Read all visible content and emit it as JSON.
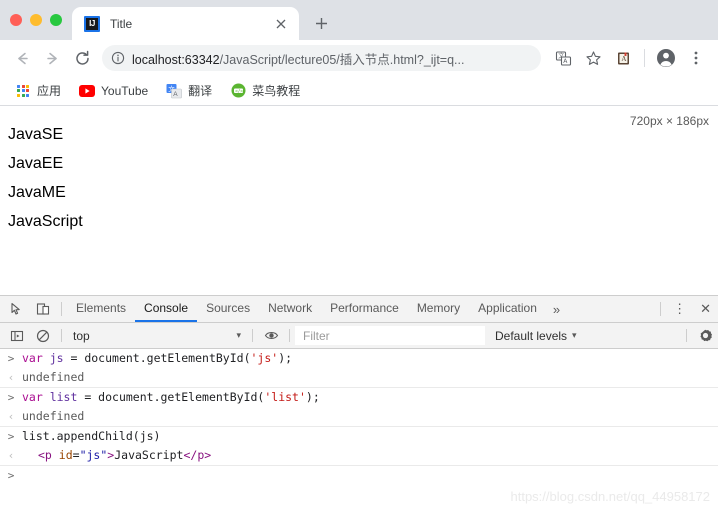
{
  "window": {
    "traffic_lights": [
      {
        "name": "close",
        "color": "#ff5f57"
      },
      {
        "name": "minimize",
        "color": "#febc2e"
      },
      {
        "name": "zoom",
        "color": "#28c840"
      }
    ]
  },
  "tabstrip": {
    "tab": {
      "favicon_label": "IJ",
      "title": "Title",
      "close_label": "×"
    },
    "new_tab_label": "+"
  },
  "toolbar": {
    "back_title": "Back",
    "forward_title": "Forward",
    "reload_title": "Reload",
    "url_host": "localhost:63342",
    "url_path": "/JavaScript/lecture05/插入节点.html?_ijt=q...",
    "url_full": "localhost:63342/JavaScript/lecture05/插入节点.html?_ijt=q...",
    "translate_title": "Translate this page",
    "bookmark_title": "Bookmark this tab",
    "extension_title": "Dictionary extension",
    "profile_title": "Profile",
    "menu_title": "Customize and control Google Chrome"
  },
  "bookmarks": [
    {
      "label": "应用",
      "icon": "apps-grid-icon"
    },
    {
      "label": "YouTube",
      "icon": "youtube-icon"
    },
    {
      "label": "翻译",
      "icon": "google-translate-icon"
    },
    {
      "label": "菜鸟教程",
      "icon": "runoob-icon"
    }
  ],
  "viewport": {
    "paragraphs": [
      "JavaSE",
      "JavaEE",
      "JavaME",
      "JavaScript"
    ],
    "dimension_tooltip": "720px × 186px"
  },
  "devtools": {
    "tabs": [
      {
        "label": "Elements",
        "active": false
      },
      {
        "label": "Console",
        "active": true
      },
      {
        "label": "Sources",
        "active": false
      },
      {
        "label": "Network",
        "active": false
      },
      {
        "label": "Performance",
        "active": false
      },
      {
        "label": "Memory",
        "active": false
      },
      {
        "label": "Application",
        "active": false
      }
    ],
    "more_tabs_label": "»",
    "dock_menu_label": "⋮",
    "close_label": "✕",
    "inspect_title": "Inspect element",
    "device_title": "Toggle device toolbar",
    "filterbar": {
      "sidebar_title": "Show console sidebar",
      "clear_title": "Clear console",
      "context": "top",
      "context_caret": "▾",
      "eye_title": "Create live expression",
      "filter_placeholder": "Filter",
      "levels": "Default levels",
      "levels_caret": "▾",
      "settings_title": "Console settings"
    },
    "prompt_input_glyph": ">",
    "prompt_output_glyph": "‹",
    "entries": [
      {
        "kind": "input",
        "tokens": [
          {
            "text": "var ",
            "type": "kw"
          },
          {
            "text": "js ",
            "type": "var"
          },
          {
            "text": "= document.getElementById(",
            "type": "plain"
          },
          {
            "text": "'js'",
            "type": "str"
          },
          {
            "text": ");",
            "type": "plain"
          }
        ]
      },
      {
        "kind": "output",
        "tokens": [
          {
            "text": "undefined",
            "type": "undef"
          }
        ]
      },
      {
        "kind": "input",
        "separator": true,
        "tokens": [
          {
            "text": "var ",
            "type": "kw"
          },
          {
            "text": "list ",
            "type": "var"
          },
          {
            "text": "= document.getElementById(",
            "type": "plain"
          },
          {
            "text": "'list'",
            "type": "str"
          },
          {
            "text": ");",
            "type": "plain"
          }
        ]
      },
      {
        "kind": "output",
        "tokens": [
          {
            "text": "undefined",
            "type": "undef"
          }
        ]
      },
      {
        "kind": "input",
        "separator": true,
        "tokens": [
          {
            "text": "list.appendChild(js)",
            "type": "plain"
          }
        ]
      },
      {
        "kind": "output",
        "indent": true,
        "tokens": [
          {
            "text": "<p",
            "type": "tag"
          },
          {
            "text": " id",
            "type": "attr"
          },
          {
            "text": "=",
            "type": "plain"
          },
          {
            "text": "\"js\"",
            "type": "aval"
          },
          {
            "text": ">",
            "type": "tag"
          },
          {
            "text": "JavaScript",
            "type": "plain"
          },
          {
            "text": "</p>",
            "type": "tag"
          }
        ]
      },
      {
        "kind": "input",
        "separator": true,
        "tokens": []
      }
    ],
    "watermark": "https://blog.csdn.net/qq_44958172"
  },
  "colors": {
    "accent": "#1a73e8",
    "chrome_tabstrip": "#dee1e6",
    "devtools_bar": "#f3f3f3",
    "keyword": "#aa0d91",
    "string": "#c41a16",
    "tag": "#881280",
    "attr": "#994500",
    "attr_value": "#1a1aa6"
  }
}
